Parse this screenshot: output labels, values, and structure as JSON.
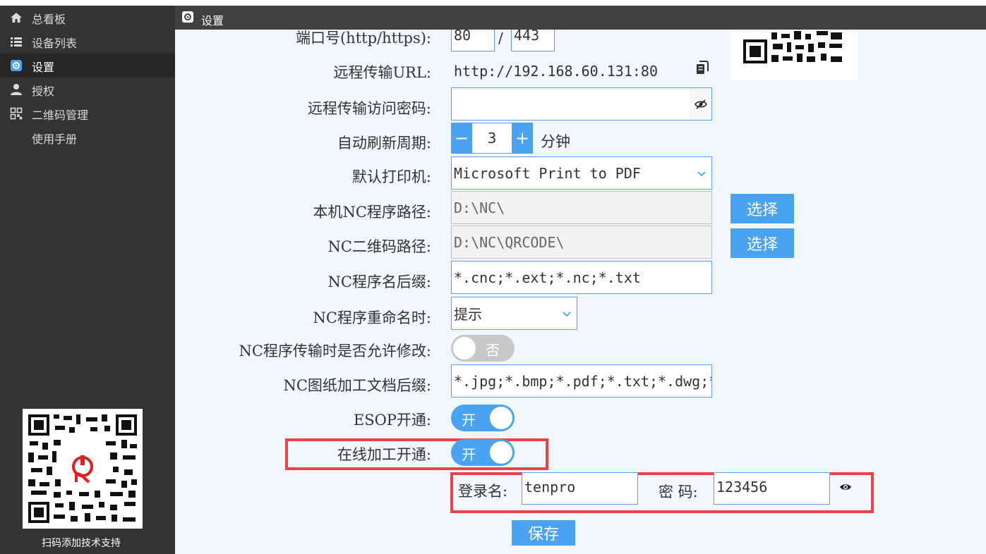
{
  "nav": {
    "items": [
      {
        "label": "总看板",
        "icon": "home-icon"
      },
      {
        "label": "设备列表",
        "icon": "list-icon"
      },
      {
        "label": "设置",
        "icon": "gear-icon"
      },
      {
        "label": "授权",
        "icon": "user-icon"
      },
      {
        "label": "二维码管理",
        "icon": "qrcode-icon"
      },
      {
        "label": "使用手册",
        "icon": ""
      }
    ],
    "active_index": 2,
    "qr_caption": "扫码添加技术支持"
  },
  "header": {
    "title": "设置",
    "icon": "gear-icon"
  },
  "form": {
    "port": {
      "label": "端口号(http/https):",
      "http": "80",
      "sep": "/",
      "https": "443"
    },
    "remote_url": {
      "label": "远程传输URL:",
      "value": "http://192.168.60.131:80",
      "icon": "copy-icon"
    },
    "remote_password": {
      "label": "远程传输访问密码:",
      "value": "",
      "icon": "eye-off-icon"
    },
    "refresh": {
      "label": "自动刷新周期:",
      "minus": "−",
      "value": "3",
      "plus": "+",
      "unit": "分钟"
    },
    "printer": {
      "label": "默认打印机:",
      "value": "Microsoft Print to PDF"
    },
    "nc_path": {
      "label": "本机NC程序路径:",
      "value": "D:\\NC\\",
      "button": "选择"
    },
    "qr_path": {
      "label": "NC二维码路径:",
      "value": "D:\\NC\\QRCODE\\",
      "button": "选择"
    },
    "suffix": {
      "label": "NC程序名后缀:",
      "value": "*.cnc;*.ext;*.nc;*.txt"
    },
    "rename": {
      "label": "NC程序重命名时:",
      "value": "提示"
    },
    "allow_modify": {
      "label": "NC程序传输时是否允许修改:",
      "state": "否",
      "on": false
    },
    "doc_suffix": {
      "label": "NC图纸加工文档后缀:",
      "value": "*.jpg;*.bmp;*.pdf;*.txt;*.dwg;*"
    },
    "esop": {
      "label": "ESOP开通:",
      "state": "开",
      "on": true
    },
    "online": {
      "label": "在线加工开通:",
      "state": "开",
      "on": true
    },
    "login": {
      "user_label": "登录名:",
      "user": "tenpro",
      "pwd_label": "密 码:",
      "pwd": "123456",
      "icon": "eye-icon"
    },
    "save": "保存"
  },
  "colors": {
    "sidebar": "#333333",
    "header": "#404040",
    "accent": "#4aa3f0",
    "highlight": "#e8454a",
    "content_bg": "#f2f7fd"
  }
}
